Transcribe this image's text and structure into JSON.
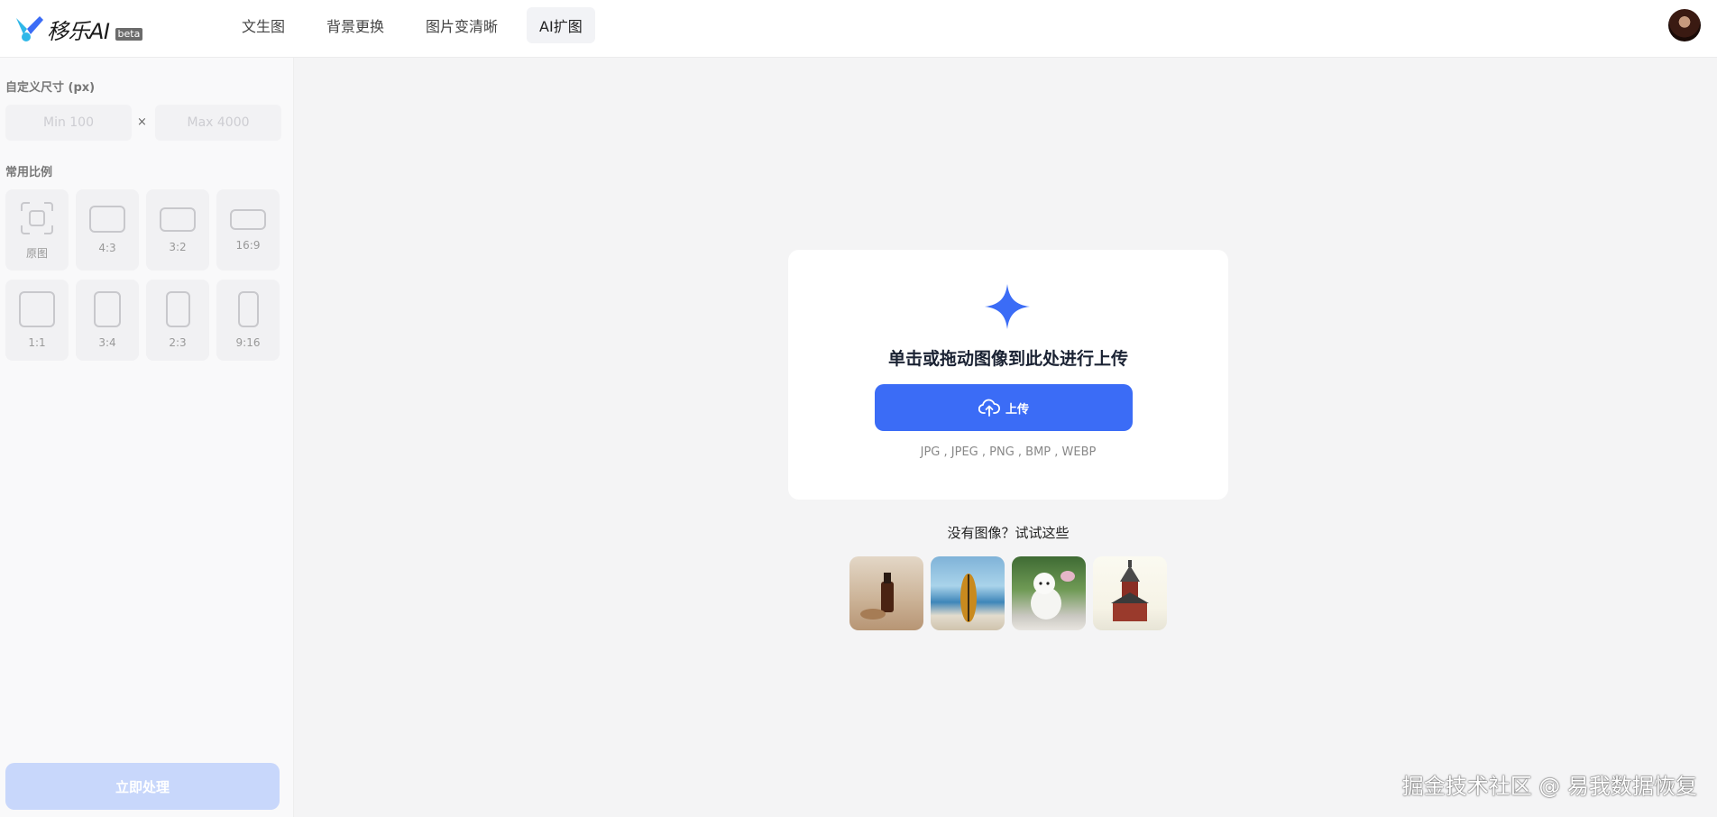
{
  "header": {
    "logo_text": "移乐AI",
    "beta_label": "beta",
    "nav": [
      {
        "label": "文生图"
      },
      {
        "label": "背景更换"
      },
      {
        "label": "图片变清晰"
      },
      {
        "label": "AI扩图",
        "active": true
      }
    ],
    "accent_color": "#3b6cf6"
  },
  "sidebar": {
    "custom_size_title": "自定义尺寸 (px)",
    "width_placeholder": "Min 100",
    "height_placeholder": "Max 4000",
    "times_symbol": "×",
    "ratio_title": "常用比例",
    "ratios": [
      {
        "label": "原图",
        "icon": "original-icon"
      },
      {
        "label": "4:3"
      },
      {
        "label": "3:2"
      },
      {
        "label": "16:9"
      },
      {
        "label": "1:1"
      },
      {
        "label": "3:4"
      },
      {
        "label": "2:3"
      },
      {
        "label": "9:16"
      }
    ],
    "process_button": "立即处理"
  },
  "upload": {
    "title": "单击或拖动图像到此处进行上传",
    "button_label": "上传",
    "formats": "JPG , JPEG , PNG , BMP , WEBP",
    "try_text": "没有图像？试试这些"
  },
  "watermark": "掘金技术社区 @ 易我数据恢复"
}
